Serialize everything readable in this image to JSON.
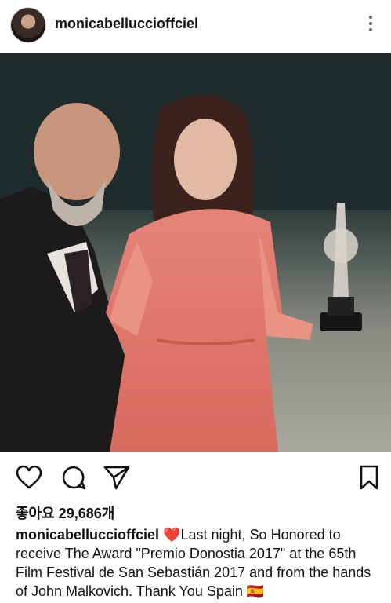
{
  "header": {
    "username": "monicabelluccioffciel"
  },
  "post": {
    "likes_label": "좋아요 29,686개",
    "caption_user": "monicabelluccioffciel",
    "caption_text": "❤️Last night,  So Honored to receive The  Award \"Premio Donostia 2017\" at the 65th Film Festival de San Sebastián 2017 and from the hands of John Malkovich. Thank You Spain 🇪🇸"
  },
  "icons": {
    "more": "more-vertical-icon",
    "like": "heart-icon",
    "comment": "comment-icon",
    "share": "send-icon",
    "save": "bookmark-icon"
  },
  "colors": {
    "dress": "#e2786c",
    "background_dark": "#1d2b2d"
  }
}
